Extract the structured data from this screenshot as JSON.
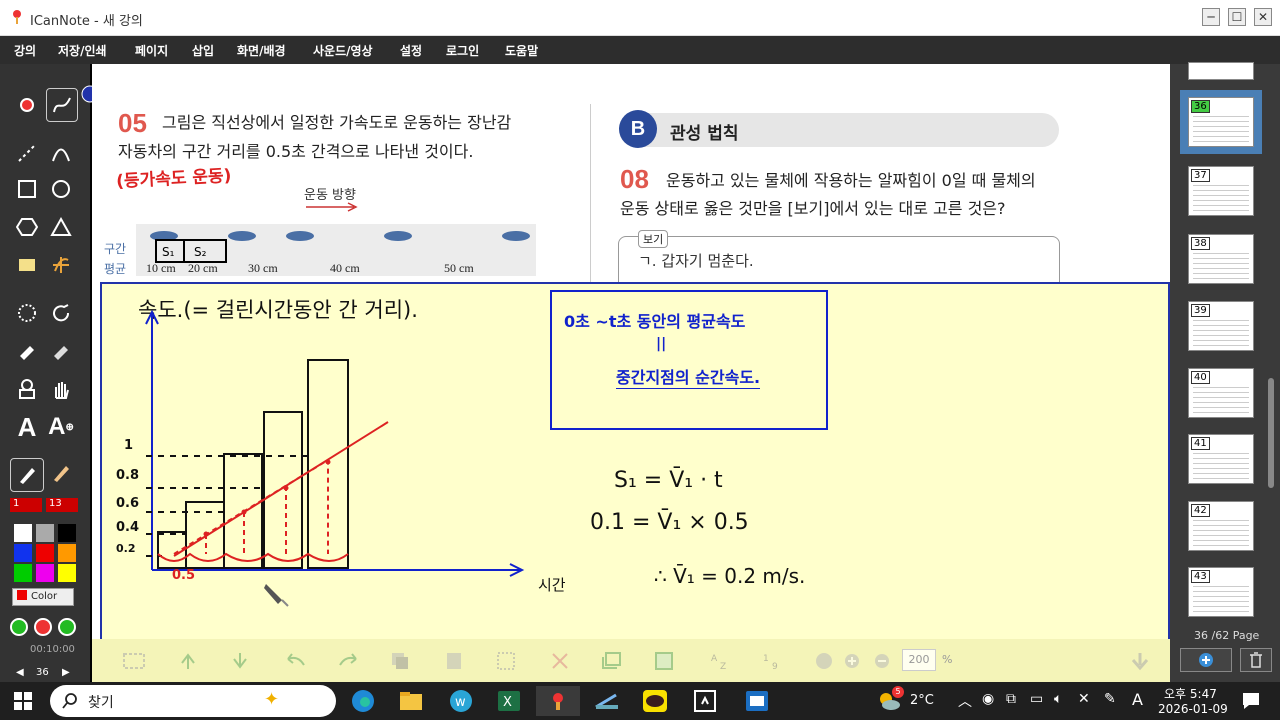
{
  "window": {
    "title": "ICanNote - 새 강의",
    "min": "─",
    "max": "☐",
    "close": "✕"
  },
  "menu": [
    "강의",
    "저장/인쇄",
    "페이지",
    "삽입",
    "화면/배경",
    "사운드/영상",
    "설정",
    "로그인",
    "도움말"
  ],
  "toolbar": {
    "pen_width": "1",
    "size": "13",
    "color_label": "Color",
    "time": "00:10:00",
    "page": "36"
  },
  "question05": {
    "number": "05",
    "line1": "그림은 직선상에서 일정한 가속도로 운동하는 장난감",
    "line2": "자동차의 구간 거리를 0.5초 간격으로 나타낸 것이다.",
    "direction": "운동 방향",
    "row_label_1": "구간",
    "row_label_2": "평균",
    "distances": [
      "10 cm",
      "20 cm",
      "30 cm",
      "40 cm",
      "50 cm"
    ]
  },
  "section": {
    "letter": "B",
    "title": "관성 법칙"
  },
  "question08": {
    "number": "08",
    "line1": "운동하고 있는 물체에 작용하는 알짜힘이 0일 때 물체의",
    "line2": "운동 상태로 옳은 것만을 [보기]에서 있는 대로 고른 것은?",
    "bogi_label": "보기",
    "bogi_item": "ㄱ. 갑자기 멈춘다."
  },
  "handwriting": {
    "red_note": "(등가속도 운동)",
    "speed_def": "속도.(= 걸린시간동안 간 거리).",
    "box_line1": "0초 ~t초 동안의 평균속도",
    "box_line2": "||",
    "box_line3": "중간지점의 순간속도.",
    "eq1": "S₁ = V̄₁ · t",
    "eq2": "0.1 = V̄₁ × 0.5",
    "eq3": "∴ V̄₁ = 0.2 m/s.",
    "time_label": "시간",
    "y_labels": [
      "1",
      "0.8",
      "0.6",
      "0.4",
      "0.2"
    ],
    "x_label": "0.5"
  },
  "bottom": {
    "zoom": "200",
    "zoom_unit": "%"
  },
  "pages": {
    "current": "36",
    "indicator": "36 /62 Page",
    "thumbs": [
      "36",
      "37",
      "38",
      "39",
      "40",
      "41",
      "42",
      "43"
    ]
  },
  "taskbar": {
    "search": "찾기",
    "weather": "2°C",
    "ampm": "오후 5:47",
    "date": "2026-01-09",
    "ime": "A",
    "badge": "5"
  },
  "colors": {
    "accent_red": "#e0584e",
    "section_blue": "#2a4a9a",
    "canvas_bg": "#ffffcc",
    "ink_blue": "#1122cc",
    "ink_red": "#dd2222"
  }
}
